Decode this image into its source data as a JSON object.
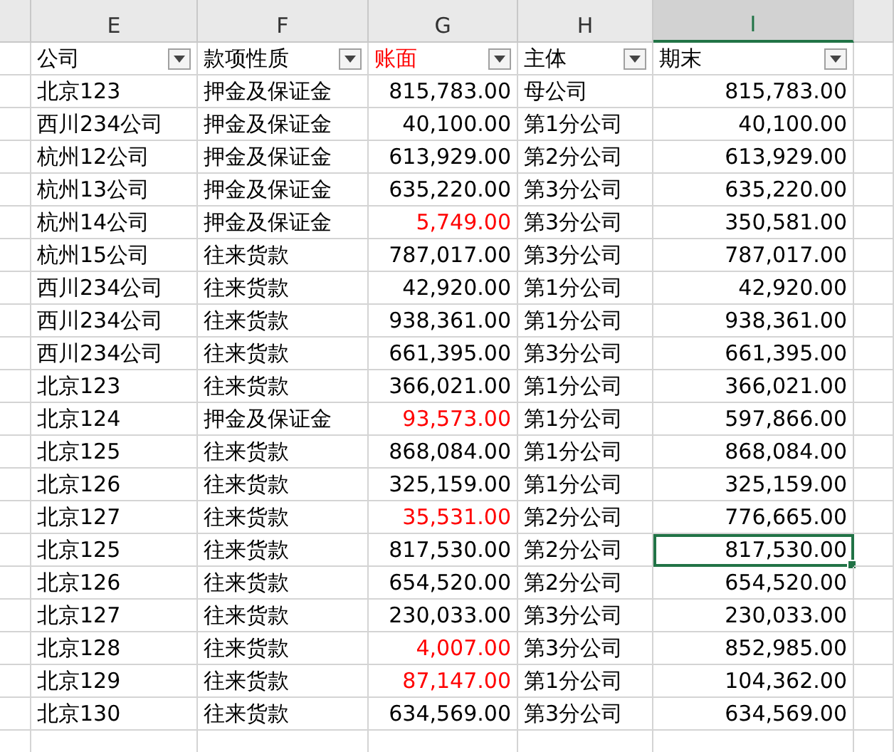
{
  "column_letters": [
    {
      "label": "E",
      "selected": false
    },
    {
      "label": "F",
      "selected": false
    },
    {
      "label": "G",
      "selected": false
    },
    {
      "label": "H",
      "selected": false
    },
    {
      "label": "I",
      "selected": true
    }
  ],
  "headers": [
    {
      "label": "公司",
      "flagged": false
    },
    {
      "label": "款项性质",
      "flagged": false
    },
    {
      "label": "账面",
      "flagged": true
    },
    {
      "label": "主体",
      "flagged": false
    },
    {
      "label": "期末",
      "flagged": false
    }
  ],
  "rows": [
    {
      "company": "北京123",
      "nature": "押金及保证金",
      "book": "815,783.00",
      "book_flagged": false,
      "entity": "母公司",
      "closing": "815,783.00",
      "selected": false
    },
    {
      "company": "西川234公司",
      "nature": "押金及保证金",
      "book": "40,100.00",
      "book_flagged": false,
      "entity": "第1分公司",
      "closing": "40,100.00",
      "selected": false
    },
    {
      "company": "杭州12公司",
      "nature": "押金及保证金",
      "book": "613,929.00",
      "book_flagged": false,
      "entity": "第2分公司",
      "closing": "613,929.00",
      "selected": false
    },
    {
      "company": "杭州13公司",
      "nature": "押金及保证金",
      "book": "635,220.00",
      "book_flagged": false,
      "entity": "第3分公司",
      "closing": "635,220.00",
      "selected": false
    },
    {
      "company": "杭州14公司",
      "nature": "押金及保证金",
      "book": "5,749.00",
      "book_flagged": true,
      "entity": "第3分公司",
      "closing": "350,581.00",
      "selected": false
    },
    {
      "company": "杭州15公司",
      "nature": "往来货款",
      "book": "787,017.00",
      "book_flagged": false,
      "entity": "第3分公司",
      "closing": "787,017.00",
      "selected": false
    },
    {
      "company": "西川234公司",
      "nature": "往来货款",
      "book": "42,920.00",
      "book_flagged": false,
      "entity": "第1分公司",
      "closing": "42,920.00",
      "selected": false
    },
    {
      "company": "西川234公司",
      "nature": "往来货款",
      "book": "938,361.00",
      "book_flagged": false,
      "entity": "第1分公司",
      "closing": "938,361.00",
      "selected": false
    },
    {
      "company": "西川234公司",
      "nature": "往来货款",
      "book": "661,395.00",
      "book_flagged": false,
      "entity": "第3分公司",
      "closing": "661,395.00",
      "selected": false
    },
    {
      "company": "北京123",
      "nature": "往来货款",
      "book": "366,021.00",
      "book_flagged": false,
      "entity": "第1分公司",
      "closing": "366,021.00",
      "selected": false
    },
    {
      "company": "北京124",
      "nature": "押金及保证金",
      "book": "93,573.00",
      "book_flagged": true,
      "entity": "第1分公司",
      "closing": "597,866.00",
      "selected": false
    },
    {
      "company": "北京125",
      "nature": "往来货款",
      "book": "868,084.00",
      "book_flagged": false,
      "entity": "第1分公司",
      "closing": "868,084.00",
      "selected": false
    },
    {
      "company": "北京126",
      "nature": "往来货款",
      "book": "325,159.00",
      "book_flagged": false,
      "entity": "第1分公司",
      "closing": "325,159.00",
      "selected": false
    },
    {
      "company": "北京127",
      "nature": "往来货款",
      "book": "35,531.00",
      "book_flagged": true,
      "entity": "第2分公司",
      "closing": "776,665.00",
      "selected": false
    },
    {
      "company": "北京125",
      "nature": "往来货款",
      "book": "817,530.00",
      "book_flagged": false,
      "entity": "第2分公司",
      "closing": "817,530.00",
      "selected": true
    },
    {
      "company": "北京126",
      "nature": "往来货款",
      "book": "654,520.00",
      "book_flagged": false,
      "entity": "第2分公司",
      "closing": "654,520.00",
      "selected": false
    },
    {
      "company": "北京127",
      "nature": "往来货款",
      "book": "230,033.00",
      "book_flagged": false,
      "entity": "第3分公司",
      "closing": "230,033.00",
      "selected": false
    },
    {
      "company": "北京128",
      "nature": "往来货款",
      "book": "4,007.00",
      "book_flagged": true,
      "entity": "第3分公司",
      "closing": "852,985.00",
      "selected": false
    },
    {
      "company": "北京129",
      "nature": "往来货款",
      "book": "87,147.00",
      "book_flagged": true,
      "entity": "第1分公司",
      "closing": "104,362.00",
      "selected": false
    },
    {
      "company": "北京130",
      "nature": "往来货款",
      "book": "634,569.00",
      "book_flagged": false,
      "entity": "第3分公司",
      "closing": "634,569.00",
      "selected": false
    }
  ]
}
